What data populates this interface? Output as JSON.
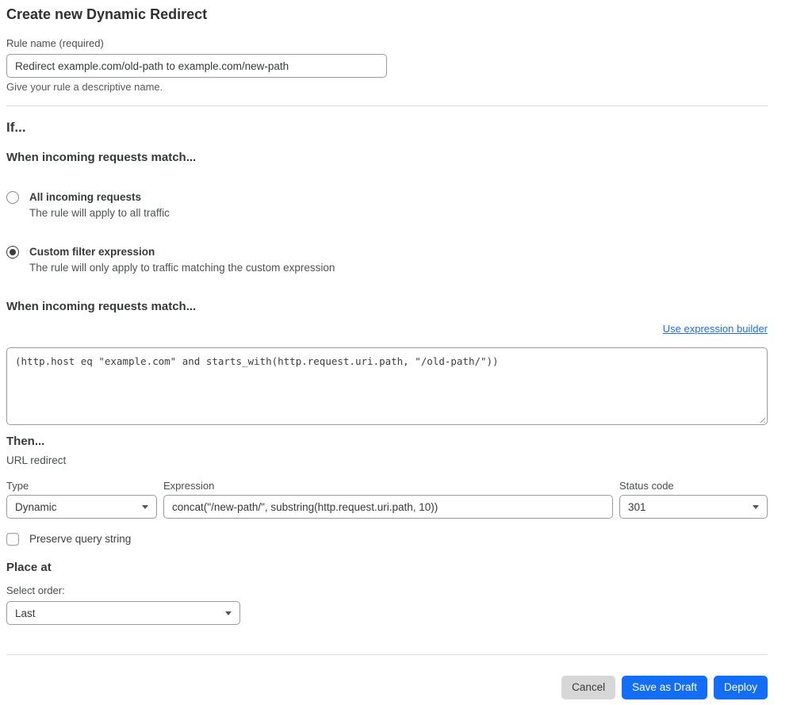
{
  "page": {
    "title": "Create new Dynamic Redirect"
  },
  "rule_name": {
    "label": "Rule name (required)",
    "value": "Redirect example.com/old-path to example.com/new-path",
    "help": "Give your rule a descriptive name."
  },
  "if_section": {
    "heading": "If...",
    "subheading": "When incoming requests match...",
    "options": [
      {
        "label": "All incoming requests",
        "description": "The rule will apply to all traffic",
        "selected": false
      },
      {
        "label": "Custom filter expression",
        "description": "The rule will only apply to traffic matching the custom expression",
        "selected": true
      }
    ]
  },
  "expression_editor": {
    "heading": "When incoming requests match...",
    "builder_link": "Use expression builder",
    "value": "(http.host eq \"example.com\" and starts_with(http.request.uri.path, \"/old-path/\"))"
  },
  "then_section": {
    "heading": "Then...",
    "action_label": "URL redirect",
    "type": {
      "label": "Type",
      "value": "Dynamic"
    },
    "expression": {
      "label": "Expression",
      "value": "concat(\"/new-path/\", substring(http.request.uri.path, 10))"
    },
    "status_code": {
      "label": "Status code",
      "value": "301"
    },
    "preserve_query": {
      "label": "Preserve query string",
      "checked": false
    }
  },
  "place_at": {
    "heading": "Place at",
    "label": "Select order:",
    "value": "Last"
  },
  "footer": {
    "cancel_label": "Cancel",
    "save_draft_label": "Save as Draft",
    "deploy_label": "Deploy"
  },
  "colors": {
    "accent_blue": "#146ef5",
    "link_blue": "#1b6ef3",
    "cancel_gray": "#d7d7d7",
    "text_dark": "#36393a",
    "border_gray": "#9a9a9a"
  }
}
